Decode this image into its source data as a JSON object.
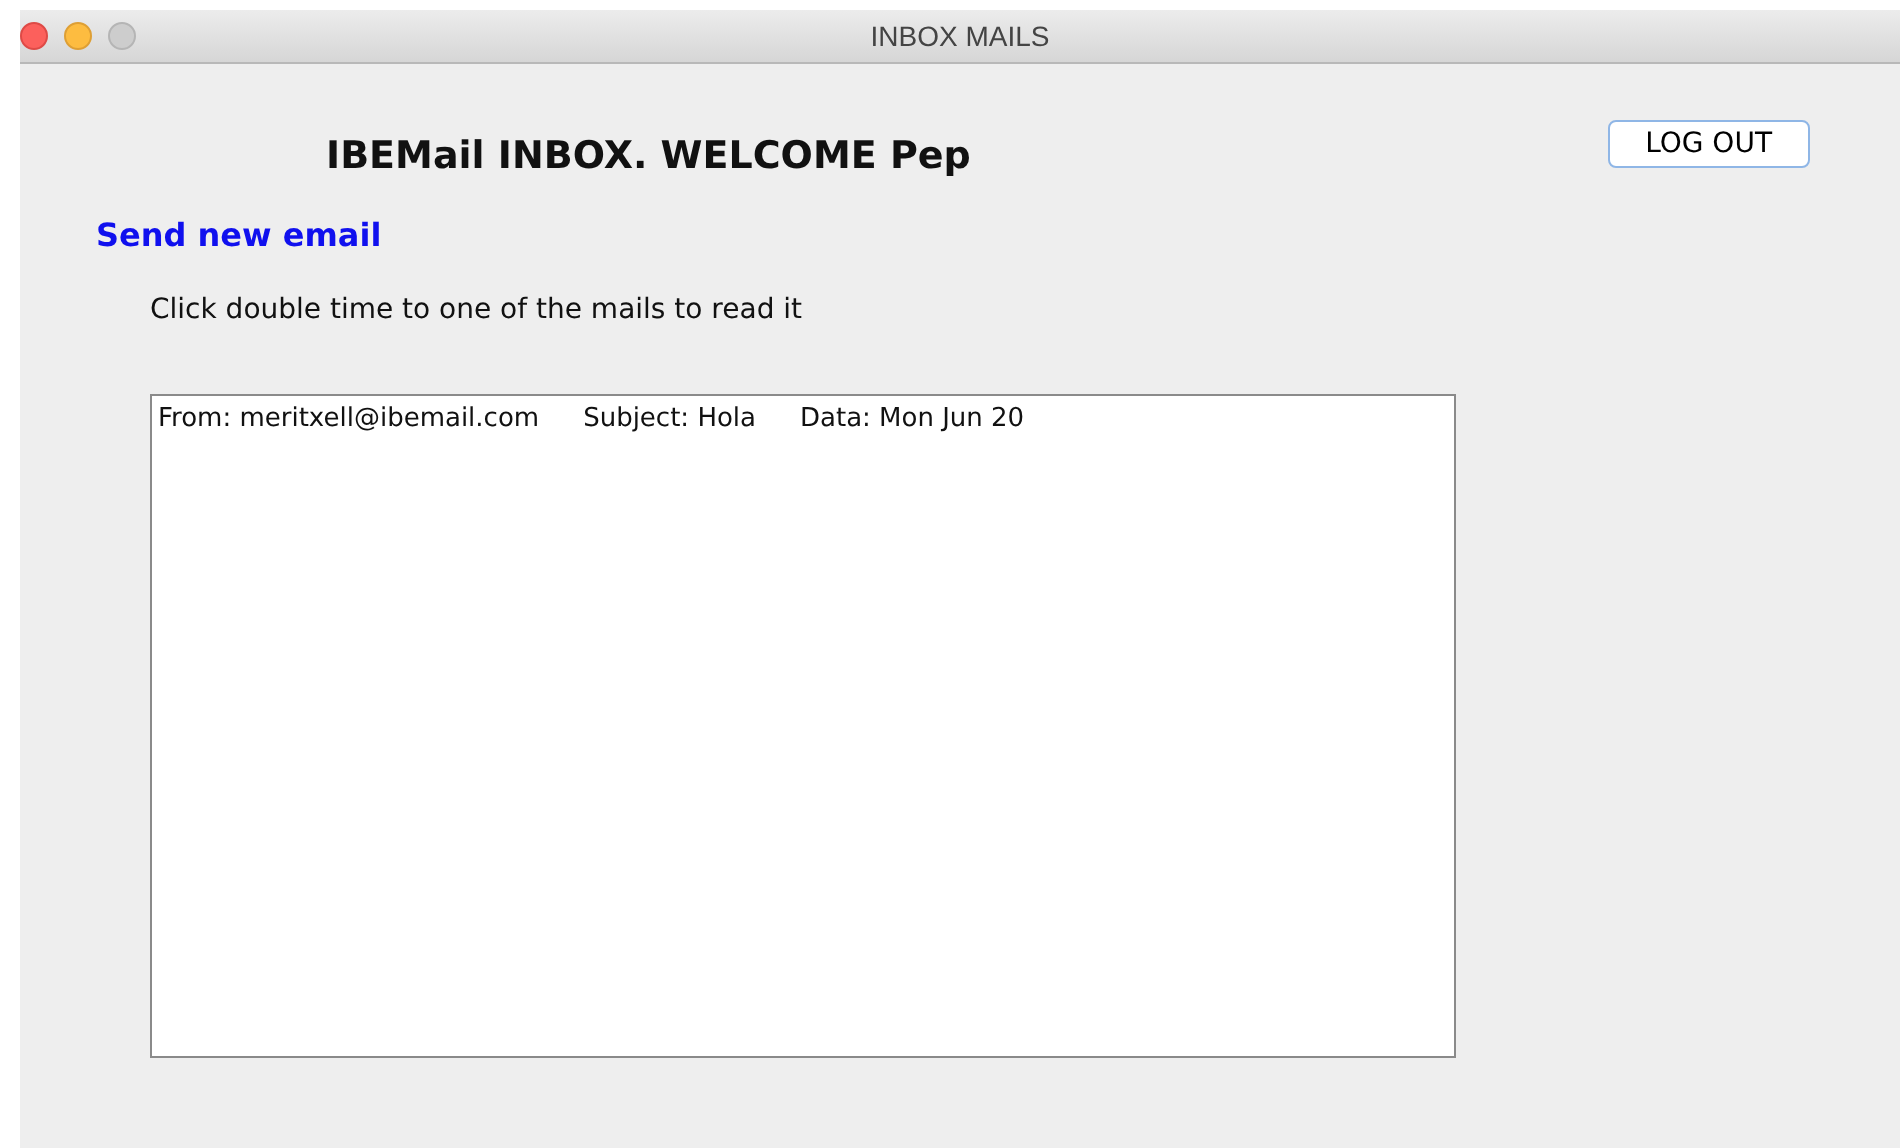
{
  "window": {
    "title": "INBOX MAILS"
  },
  "heading": "IBEMail INBOX. WELCOME Pep",
  "logout_button": "LOG OUT",
  "send_link": "Send new email",
  "instructions": "Click double time to one of the mails to read it",
  "mails": [
    {
      "from": "From: meritxell@ibemail.com",
      "subject": "Subject: Hola",
      "date": "Data: Mon Jun 20"
    }
  ]
}
